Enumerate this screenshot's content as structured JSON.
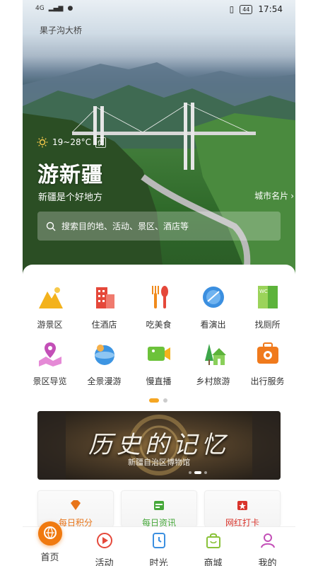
{
  "status": {
    "signal": "4G",
    "battery": "44",
    "time": "17:54"
  },
  "location": "果子沟大桥",
  "weather": {
    "temp": "19~28°C",
    "aq": "优",
    "icon": "sun-icon"
  },
  "hero": {
    "title": "游新疆",
    "subtitle": "新疆是个好地方",
    "city_card": "城市名片"
  },
  "search": {
    "placeholder": "搜索目的地、活动、景区、酒店等"
  },
  "services": [
    {
      "label": "游景区",
      "icon": "scenic-mountain-icon"
    },
    {
      "label": "住酒店",
      "icon": "hotel-icon"
    },
    {
      "label": "吃美食",
      "icon": "food-icon"
    },
    {
      "label": "看演出",
      "icon": "show-icon"
    },
    {
      "label": "找厕所",
      "icon": "toilet-icon"
    },
    {
      "label": "景区导览",
      "icon": "map-guide-icon"
    },
    {
      "label": "全景漫游",
      "icon": "panorama-icon"
    },
    {
      "label": "慢直播",
      "icon": "live-camera-icon"
    },
    {
      "label": "乡村旅游",
      "icon": "village-icon"
    },
    {
      "label": "出行服务",
      "icon": "travel-service-icon"
    }
  ],
  "banner": {
    "title": "历史的记忆",
    "subtitle": "新疆自治区博物馆"
  },
  "cards": [
    {
      "label": "每日积分",
      "color": "#e8751a"
    },
    {
      "label": "每日资讯",
      "color": "#46a83a"
    },
    {
      "label": "网红打卡",
      "color": "#d9342c"
    }
  ],
  "tabs": [
    {
      "label": "首页",
      "icon": "home-icon"
    },
    {
      "label": "活动",
      "icon": "activity-icon"
    },
    {
      "label": "时光",
      "icon": "time-icon"
    },
    {
      "label": "商城",
      "icon": "mall-icon"
    },
    {
      "label": "我的",
      "icon": "profile-icon"
    }
  ]
}
